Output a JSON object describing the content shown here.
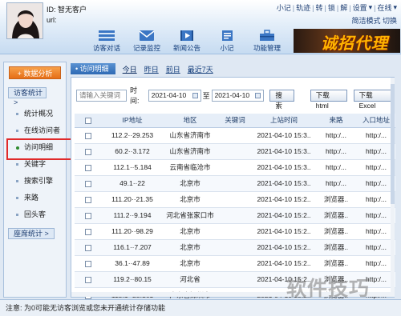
{
  "header": {
    "user_id": "ID: 智无客户",
    "user_url": "url:",
    "top_links": [
      "小记",
      "轨迹",
      "转",
      "锁",
      "解"
    ],
    "settings": "设置",
    "status": "在线",
    "mode": "简洁模式 切换",
    "nav": [
      {
        "label": "访客对话",
        "icon": "dialog-icon"
      },
      {
        "label": "记录监控",
        "icon": "mail-icon"
      },
      {
        "label": "新闻公告",
        "icon": "film-icon"
      },
      {
        "label": "小记",
        "icon": "notebook-icon"
      },
      {
        "label": "功能管理",
        "icon": "toolbox-icon"
      }
    ],
    "banner": "诚招代理商"
  },
  "sidebar": {
    "analysis_button": "+ 数据分析",
    "section_visitor": "访客统计 >",
    "items": [
      "统计概况",
      "在线访问者",
      "访问明细",
      "关键字",
      "搜索引擎",
      "来路",
      "回头客"
    ],
    "section_seat": "座席统计 >"
  },
  "tabs": {
    "active": "访问明细",
    "links": [
      "今日",
      "昨日",
      "前日",
      "最近7天"
    ]
  },
  "filter": {
    "keyword_placeholder": "请输入关键词",
    "time_label": "时间:",
    "date_from": "2021-04-10",
    "to_label": "至",
    "date_to": "2021-04-10",
    "search": "搜索",
    "download_html": "下载html",
    "download_excel": "下载Excel"
  },
  "table": {
    "columns": [
      "",
      "IP地址",
      "地区",
      "关键词",
      "上站时间",
      "来路",
      "入口地址"
    ],
    "rows": [
      {
        "ip": "112.2··29.253",
        "region": "山东省济南市",
        "keyword": "",
        "time": "2021-04-10 15:3..",
        "source": "http:/...",
        "entry": "http:/..."
      },
      {
        "ip": "60.2··3.172",
        "region": "山东省济南市",
        "keyword": "",
        "time": "2021-04-10 15:3..",
        "source": "http:/...",
        "entry": "http:/..."
      },
      {
        "ip": "112.1··5.184",
        "region": "云南省临沧市",
        "keyword": "",
        "time": "2021-04-10 15:3..",
        "source": "http:/...",
        "entry": "http:/..."
      },
      {
        "ip": "49.1··22",
        "region": "北京市",
        "keyword": "",
        "time": "2021-04-10 15:3..",
        "source": "http:/...",
        "entry": "http:/..."
      },
      {
        "ip": "111.20··21.35",
        "region": "北京市",
        "keyword": "",
        "time": "2021-04-10 15:2..",
        "source": "浏览器..",
        "entry": "http:/..."
      },
      {
        "ip": "111.2··9.194",
        "region": "河北省张家口市",
        "keyword": "",
        "time": "2021-04-10 15:2..",
        "source": "浏览器..",
        "entry": "http:/..."
      },
      {
        "ip": "111.20··98.29",
        "region": "北京市",
        "keyword": "",
        "time": "2021-04-10 15:2..",
        "source": "浏览器..",
        "entry": "http:/..."
      },
      {
        "ip": "116.1··7.207",
        "region": "北京市",
        "keyword": "",
        "time": "2021-04-10 15:2..",
        "source": "浏览器..",
        "entry": "http:/..."
      },
      {
        "ip": "36.1··47.89",
        "region": "北京市",
        "keyword": "",
        "time": "2021-04-10 15:2..",
        "source": "浏览器..",
        "entry": "http:/..."
      },
      {
        "ip": "119.2··80.15",
        "region": "河北省",
        "keyword": "",
        "time": "2021-04-10 15:2..",
        "source": "浏览器..",
        "entry": "http:/..."
      },
      {
        "ip": "113.1··25.161",
        "region": "广东省深圳市",
        "keyword": "",
        "time": "2021-04-10 15:2..",
        "source": "浏览器..",
        "entry": "http:/..."
      }
    ]
  },
  "status_bar": "注意: 为0可能无访客浏览或您未开通统计存储功能",
  "watermark": "软件技巧",
  "colors": {
    "accent": "#2e6ab4",
    "orange_button": "#e66e16",
    "highlight_box": "#e02a2a"
  }
}
